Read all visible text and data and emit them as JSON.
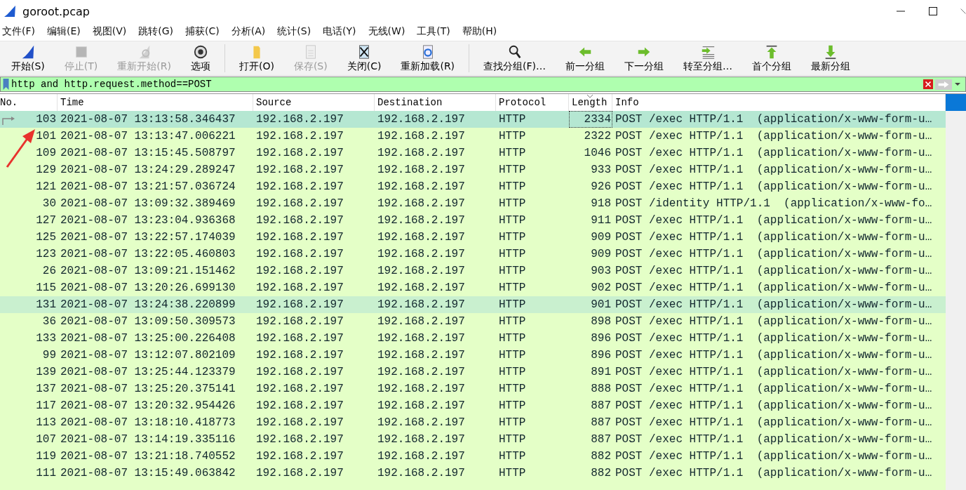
{
  "window": {
    "title": "goroot.pcap"
  },
  "menu": [
    "文件(F)",
    "编辑(E)",
    "视图(V)",
    "跳转(G)",
    "捕获(C)",
    "分析(A)",
    "统计(S)",
    "电话(Y)",
    "无线(W)",
    "工具(T)",
    "帮助(H)"
  ],
  "toolbar": [
    {
      "kind": "fin",
      "label": "开始(S)",
      "disabled": false
    },
    {
      "kind": "stop",
      "label": "停止(T)",
      "disabled": true
    },
    {
      "kind": "restart",
      "label": "重新开始(R)",
      "disabled": true
    },
    {
      "kind": "gear",
      "label": "选项",
      "disabled": false
    },
    {
      "kind": "sep"
    },
    {
      "kind": "folder",
      "label": "打开(O)",
      "disabled": false
    },
    {
      "kind": "save",
      "label": "保存(S)",
      "disabled": true
    },
    {
      "kind": "closefile",
      "label": "关闭(C)",
      "disabled": false
    },
    {
      "kind": "reload",
      "label": "重新加载(R)",
      "disabled": false
    },
    {
      "kind": "sep"
    },
    {
      "kind": "find",
      "label": "查找分组(F)…",
      "disabled": false
    },
    {
      "kind": "back",
      "label": "前一分组",
      "disabled": false
    },
    {
      "kind": "forward",
      "label": "下一分组",
      "disabled": false
    },
    {
      "kind": "goto",
      "label": "转至分组…",
      "disabled": false
    },
    {
      "kind": "first",
      "label": "首个分组",
      "disabled": false
    },
    {
      "kind": "last",
      "label": "最新分组",
      "disabled": false
    }
  ],
  "filter": {
    "value": "http and http.request.method==POST"
  },
  "table": {
    "columns": [
      "No.",
      "Time",
      "Source",
      "Destination",
      "Protocol",
      "Length",
      "Info"
    ],
    "rows": [
      {
        "no": "103",
        "time": "2021-08-07 13:13:58.346437",
        "source": "192.168.2.197",
        "destination": "192.168.2.197",
        "protocol": "HTTP",
        "length": "2334",
        "info": "POST /exec HTTP/1.1  (application/x-www-form-u…",
        "selected": true,
        "highlighted": false
      },
      {
        "no": "101",
        "time": "2021-08-07 13:13:47.006221",
        "source": "192.168.2.197",
        "destination": "192.168.2.197",
        "protocol": "HTTP",
        "length": "2322",
        "info": "POST /exec HTTP/1.1  (application/x-www-form-u…",
        "selected": false,
        "highlighted": false
      },
      {
        "no": "109",
        "time": "2021-08-07 13:15:45.508797",
        "source": "192.168.2.197",
        "destination": "192.168.2.197",
        "protocol": "HTTP",
        "length": "1046",
        "info": "POST /exec HTTP/1.1  (application/x-www-form-u…",
        "selected": false,
        "highlighted": false
      },
      {
        "no": "129",
        "time": "2021-08-07 13:24:29.289247",
        "source": "192.168.2.197",
        "destination": "192.168.2.197",
        "protocol": "HTTP",
        "length": "933",
        "info": "POST /exec HTTP/1.1  (application/x-www-form-u…",
        "selected": false,
        "highlighted": false
      },
      {
        "no": "121",
        "time": "2021-08-07 13:21:57.036724",
        "source": "192.168.2.197",
        "destination": "192.168.2.197",
        "protocol": "HTTP",
        "length": "926",
        "info": "POST /exec HTTP/1.1  (application/x-www-form-u…",
        "selected": false,
        "highlighted": false
      },
      {
        "no": "30",
        "time": "2021-08-07 13:09:32.389469",
        "source": "192.168.2.197",
        "destination": "192.168.2.197",
        "protocol": "HTTP",
        "length": "918",
        "info": "POST /identity HTTP/1.1  (application/x-www-fo…",
        "selected": false,
        "highlighted": false
      },
      {
        "no": "127",
        "time": "2021-08-07 13:23:04.936368",
        "source": "192.168.2.197",
        "destination": "192.168.2.197",
        "protocol": "HTTP",
        "length": "911",
        "info": "POST /exec HTTP/1.1  (application/x-www-form-u…",
        "selected": false,
        "highlighted": false
      },
      {
        "no": "125",
        "time": "2021-08-07 13:22:57.174039",
        "source": "192.168.2.197",
        "destination": "192.168.2.197",
        "protocol": "HTTP",
        "length": "909",
        "info": "POST /exec HTTP/1.1  (application/x-www-form-u…",
        "selected": false,
        "highlighted": false
      },
      {
        "no": "123",
        "time": "2021-08-07 13:22:05.460803",
        "source": "192.168.2.197",
        "destination": "192.168.2.197",
        "protocol": "HTTP",
        "length": "909",
        "info": "POST /exec HTTP/1.1  (application/x-www-form-u…",
        "selected": false,
        "highlighted": false
      },
      {
        "no": "26",
        "time": "2021-08-07 13:09:21.151462",
        "source": "192.168.2.197",
        "destination": "192.168.2.197",
        "protocol": "HTTP",
        "length": "903",
        "info": "POST /exec HTTP/1.1  (application/x-www-form-u…",
        "selected": false,
        "highlighted": false
      },
      {
        "no": "115",
        "time": "2021-08-07 13:20:26.699130",
        "source": "192.168.2.197",
        "destination": "192.168.2.197",
        "protocol": "HTTP",
        "length": "902",
        "info": "POST /exec HTTP/1.1  (application/x-www-form-u…",
        "selected": false,
        "highlighted": false
      },
      {
        "no": "131",
        "time": "2021-08-07 13:24:38.220899",
        "source": "192.168.2.197",
        "destination": "192.168.2.197",
        "protocol": "HTTP",
        "length": "901",
        "info": "POST /exec HTTP/1.1  (application/x-www-form-u…",
        "selected": false,
        "highlighted": true
      },
      {
        "no": "36",
        "time": "2021-08-07 13:09:50.309573",
        "source": "192.168.2.197",
        "destination": "192.168.2.197",
        "protocol": "HTTP",
        "length": "898",
        "info": "POST /exec HTTP/1.1  (application/x-www-form-u…",
        "selected": false,
        "highlighted": false
      },
      {
        "no": "133",
        "time": "2021-08-07 13:25:00.226408",
        "source": "192.168.2.197",
        "destination": "192.168.2.197",
        "protocol": "HTTP",
        "length": "896",
        "info": "POST /exec HTTP/1.1  (application/x-www-form-u…",
        "selected": false,
        "highlighted": false
      },
      {
        "no": "99",
        "time": "2021-08-07 13:12:07.802109",
        "source": "192.168.2.197",
        "destination": "192.168.2.197",
        "protocol": "HTTP",
        "length": "896",
        "info": "POST /exec HTTP/1.1  (application/x-www-form-u…",
        "selected": false,
        "highlighted": false
      },
      {
        "no": "139",
        "time": "2021-08-07 13:25:44.123379",
        "source": "192.168.2.197",
        "destination": "192.168.2.197",
        "protocol": "HTTP",
        "length": "891",
        "info": "POST /exec HTTP/1.1  (application/x-www-form-u…",
        "selected": false,
        "highlighted": false
      },
      {
        "no": "137",
        "time": "2021-08-07 13:25:20.375141",
        "source": "192.168.2.197",
        "destination": "192.168.2.197",
        "protocol": "HTTP",
        "length": "888",
        "info": "POST /exec HTTP/1.1  (application/x-www-form-u…",
        "selected": false,
        "highlighted": false
      },
      {
        "no": "117",
        "time": "2021-08-07 13:20:32.954426",
        "source": "192.168.2.197",
        "destination": "192.168.2.197",
        "protocol": "HTTP",
        "length": "887",
        "info": "POST /exec HTTP/1.1  (application/x-www-form-u…",
        "selected": false,
        "highlighted": false
      },
      {
        "no": "113",
        "time": "2021-08-07 13:18:10.418773",
        "source": "192.168.2.197",
        "destination": "192.168.2.197",
        "protocol": "HTTP",
        "length": "887",
        "info": "POST /exec HTTP/1.1  (application/x-www-form-u…",
        "selected": false,
        "highlighted": false
      },
      {
        "no": "107",
        "time": "2021-08-07 13:14:19.335116",
        "source": "192.168.2.197",
        "destination": "192.168.2.197",
        "protocol": "HTTP",
        "length": "887",
        "info": "POST /exec HTTP/1.1  (application/x-www-form-u…",
        "selected": false,
        "highlighted": false
      },
      {
        "no": "119",
        "time": "2021-08-07 13:21:18.740552",
        "source": "192.168.2.197",
        "destination": "192.168.2.197",
        "protocol": "HTTP",
        "length": "882",
        "info": "POST /exec HTTP/1.1  (application/x-www-form-u…",
        "selected": false,
        "highlighted": false
      },
      {
        "no": "111",
        "time": "2021-08-07 13:15:49.063842",
        "source": "192.168.2.197",
        "destination": "192.168.2.197",
        "protocol": "HTTP",
        "length": "882",
        "info": "POST /exec HTTP/1.1  (application/x-www-form-u…",
        "selected": false,
        "highlighted": false
      }
    ]
  }
}
